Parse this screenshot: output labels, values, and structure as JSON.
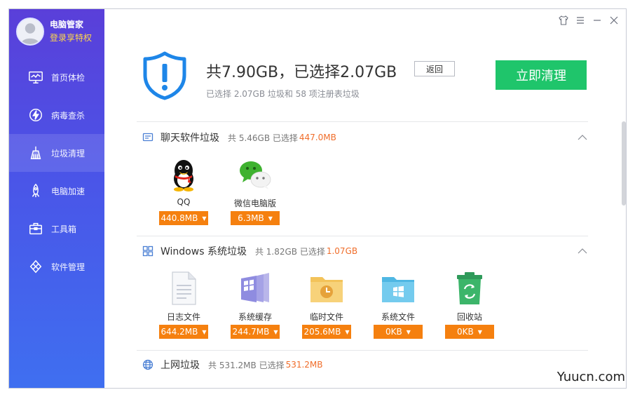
{
  "profile": {
    "name": "电脑管家",
    "login": "登录享特权"
  },
  "nav": [
    {
      "label": "首页体检",
      "icon": "monitor-icon"
    },
    {
      "label": "病毒查杀",
      "icon": "lightning-icon"
    },
    {
      "label": "垃圾清理",
      "icon": "broom-icon",
      "active": true
    },
    {
      "label": "电脑加速",
      "icon": "rocket-icon"
    },
    {
      "label": "工具箱",
      "icon": "toolbox-icon"
    },
    {
      "label": "软件管理",
      "icon": "software-icon"
    }
  ],
  "summary": {
    "headline": "共7.90GB，已选择2.07GB",
    "back_label": "返回",
    "subtitle": "已选择 2.07GB 垃圾和 58 项注册表垃圾",
    "clean_label": "立即清理"
  },
  "sections": {
    "chat": {
      "title": "聊天软件垃圾",
      "meta": "共 5.46GB 已选择",
      "selected": "447.0MB",
      "items": [
        {
          "label": "QQ",
          "size": "440.8MB",
          "icon": "qq-icon"
        },
        {
          "label": "微信电脑版",
          "size": "6.3MB",
          "icon": "wechat-icon"
        }
      ]
    },
    "windows": {
      "title": "Windows 系统垃圾",
      "meta": "共 1.82GB 已选择",
      "selected": "1.07GB",
      "items": [
        {
          "label": "日志文件",
          "size": "644.2MB",
          "icon": "log-file-icon"
        },
        {
          "label": "系统缓存",
          "size": "244.7MB",
          "icon": "system-cache-icon"
        },
        {
          "label": "临时文件",
          "size": "205.6MB",
          "icon": "temp-folder-icon"
        },
        {
          "label": "系统文件",
          "size": "0KB",
          "icon": "system-folder-icon"
        },
        {
          "label": "回收站",
          "size": "0KB",
          "icon": "recycle-bin-icon"
        }
      ]
    },
    "internet": {
      "title": "上网垃圾",
      "meta": "共 531.2MB 已选择",
      "selected": "531.2MB"
    }
  },
  "watermark": "Yuucn.com",
  "colors": {
    "accent": "#1fc56b",
    "selected_text": "#f06d2a",
    "size_button": "#f5800f",
    "sidebar": "#4a55e8"
  }
}
